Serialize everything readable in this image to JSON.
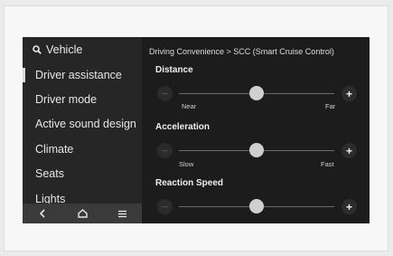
{
  "sidebar": {
    "search_label": "Vehicle",
    "items": [
      {
        "label": "Driver assistance"
      },
      {
        "label": "Driver mode"
      },
      {
        "label": "Active sound design"
      },
      {
        "label": "Climate"
      },
      {
        "label": "Seats"
      },
      {
        "label": "Lights"
      }
    ],
    "selected_index": 0
  },
  "bottom_bar": {
    "buttons": [
      "back-icon",
      "home-icon",
      "menu-icon"
    ]
  },
  "breadcrumb": "Driving Convenience > SCC (Smart Cruise Control)",
  "sections": [
    {
      "title": "Distance",
      "min_label": "Near",
      "max_label": "Far",
      "level": 0.5
    },
    {
      "title": "Acceleration",
      "min_label": "Slow",
      "max_label": "Fast",
      "level": 0.5
    },
    {
      "title": "Reaction Speed",
      "min_label": "",
      "max_label": "",
      "level": 0.5
    }
  ],
  "colors": {
    "screen_bg": "#1c1c1c",
    "sidebar_bg": "#262626",
    "thumb": "#cfcfcf"
  }
}
